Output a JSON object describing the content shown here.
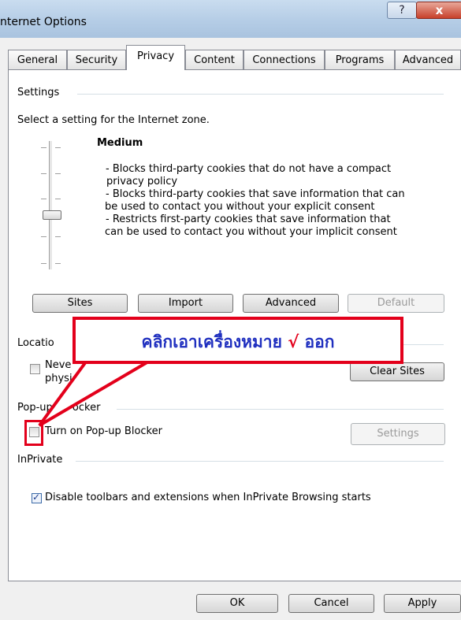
{
  "window": {
    "title": "nternet Options",
    "help_label": "?",
    "close_label": "x"
  },
  "tabs": [
    {
      "label": "General"
    },
    {
      "label": "Security"
    },
    {
      "label": "Privacy",
      "active": true
    },
    {
      "label": "Content"
    },
    {
      "label": "Connections"
    },
    {
      "label": "Programs"
    },
    {
      "label": "Advanced"
    }
  ],
  "settings": {
    "group_label": "Settings",
    "prompt": "Select a setting for the Internet zone.",
    "level_name": "Medium",
    "description": [
      "- Blocks third-party cookies that do not have a compact",
      "privacy policy",
      "- Blocks third-party cookies that save information that can",
      "be used to contact you without your explicit consent",
      "- Restricts first-party cookies that save information that",
      "can be used to contact you without your implicit consent"
    ],
    "buttons": {
      "sites": "Sites",
      "import": "Import",
      "advanced": "Advanced",
      "default": "Default"
    }
  },
  "location": {
    "group_label": "Locatio",
    "checkbox_label_line1": "Neve",
    "checkbox_label_line2": "physical loc",
    "clear_sites_label": "Clear Sites"
  },
  "popup_blocker": {
    "group_label": "Pop-up Blocker",
    "group_label_visible": "Pop-up ",
    "group_label_tail": "ocker",
    "checkbox_label": "Turn on Pop-up Blocker",
    "checked": false,
    "settings_label": "Settings"
  },
  "inprivate": {
    "group_label": "InPrivate",
    "checkbox_label": "Disable toolbars and extensions when InPrivate Browsing starts",
    "checked": true
  },
  "footer": {
    "ok": "OK",
    "cancel": "Cancel",
    "apply": "Apply"
  },
  "annotation": {
    "text_before": "คลิกเอาเครื่องหมาย",
    "mark": "√",
    "text_after": "ออก",
    "color": "#e3001b",
    "text_color": "#1f2fbf"
  }
}
